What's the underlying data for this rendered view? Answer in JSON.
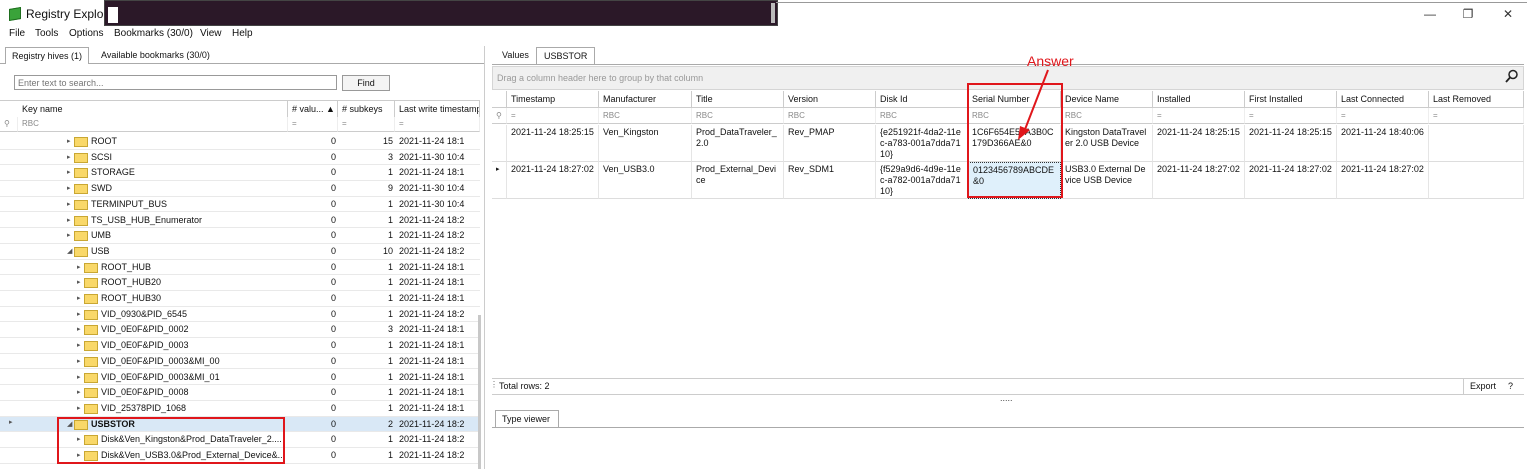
{
  "window": {
    "title": "Registry Explore",
    "minimize": "—",
    "maximize": "❐",
    "close": "✕"
  },
  "menu": [
    "File",
    "Tools",
    "Options",
    "Bookmarks (30/0)",
    "View",
    "Help"
  ],
  "left_tabs": [
    "Registry hives (1)",
    "Available bookmarks (30/0)"
  ],
  "search": {
    "placeholder": "Enter text to search...",
    "find_label": "Find"
  },
  "left_grid": {
    "headers": [
      "Key name",
      "# valu...",
      "# subkeys",
      "Last write timestamp"
    ],
    "filter_glyph": "RBC",
    "filter_eq": "=",
    "rows": [
      {
        "name": "ROOT",
        "values": "0",
        "subkeys": "15",
        "ts": "2021-11-24 18:1",
        "level": 1
      },
      {
        "name": "SCSI",
        "values": "0",
        "subkeys": "3",
        "ts": "2021-11-30 10:4",
        "level": 1
      },
      {
        "name": "STORAGE",
        "values": "0",
        "subkeys": "1",
        "ts": "2021-11-24 18:1",
        "level": 1
      },
      {
        "name": "SWD",
        "values": "0",
        "subkeys": "9",
        "ts": "2021-11-30 10:4",
        "level": 1
      },
      {
        "name": "TERMINPUT_BUS",
        "values": "0",
        "subkeys": "1",
        "ts": "2021-11-30 10:4",
        "level": 1
      },
      {
        "name": "TS_USB_HUB_Enumerator",
        "values": "0",
        "subkeys": "1",
        "ts": "2021-11-24 18:2",
        "level": 1
      },
      {
        "name": "UMB",
        "values": "0",
        "subkeys": "1",
        "ts": "2021-11-24 18:2",
        "level": 1
      },
      {
        "name": "USB",
        "values": "0",
        "subkeys": "10",
        "ts": "2021-11-24 18:2",
        "level": 1
      },
      {
        "name": "ROOT_HUB",
        "values": "0",
        "subkeys": "1",
        "ts": "2021-11-24 18:1",
        "level": 2
      },
      {
        "name": "ROOT_HUB20",
        "values": "0",
        "subkeys": "1",
        "ts": "2021-11-24 18:1",
        "level": 2
      },
      {
        "name": "ROOT_HUB30",
        "values": "0",
        "subkeys": "1",
        "ts": "2021-11-24 18:1",
        "level": 2
      },
      {
        "name": "VID_0930&PID_6545",
        "values": "0",
        "subkeys": "1",
        "ts": "2021-11-24 18:2",
        "level": 2
      },
      {
        "name": "VID_0E0F&PID_0002",
        "values": "0",
        "subkeys": "3",
        "ts": "2021-11-24 18:1",
        "level": 2
      },
      {
        "name": "VID_0E0F&PID_0003",
        "values": "0",
        "subkeys": "1",
        "ts": "2021-11-24 18:1",
        "level": 2
      },
      {
        "name": "VID_0E0F&PID_0003&MI_00",
        "values": "0",
        "subkeys": "1",
        "ts": "2021-11-24 18:1",
        "level": 2
      },
      {
        "name": "VID_0E0F&PID_0003&MI_01",
        "values": "0",
        "subkeys": "1",
        "ts": "2021-11-24 18:1",
        "level": 2
      },
      {
        "name": "VID_0E0F&PID_0008",
        "values": "0",
        "subkeys": "1",
        "ts": "2021-11-24 18:1",
        "level": 2
      },
      {
        "name": "VID_25378PID_1068",
        "values": "0",
        "subkeys": "1",
        "ts": "2021-11-24 18:1",
        "level": 2
      },
      {
        "name": "USBSTOR",
        "values": "0",
        "subkeys": "2",
        "ts": "2021-11-24 18:2",
        "level": 1,
        "selected": true
      },
      {
        "name": "Disk&Ven_Kingston&Prod_DataTraveler_2....",
        "values": "0",
        "subkeys": "1",
        "ts": "2021-11-24 18:2",
        "level": 2
      },
      {
        "name": "Disk&Ven_USB3.0&Prod_External_Device&...",
        "values": "0",
        "subkeys": "1",
        "ts": "2021-11-24 18:2",
        "level": 2
      }
    ]
  },
  "right_tabs": [
    "Values",
    "USBSTOR"
  ],
  "group_hint": "Drag a column header here to group by that column",
  "right_grid": {
    "headers": [
      "Timestamp",
      "Manufacturer",
      "Title",
      "Version",
      "Disk Id",
      "Serial Number",
      "Device Name",
      "Installed",
      "First Installed",
      "Last Connected",
      "Last Removed"
    ],
    "rows": [
      [
        "2021-11-24 18:25:15",
        "Ven_Kingston",
        "Prod_DataTraveler_2.0",
        "Rev_PMAP",
        "{e251921f-4da2-11ec-a783-001a7dda7110}",
        "1C6F654E59A3B0C179D366AE&0",
        "Kingston DataTraveler 2.0 USB Device",
        "2021-11-24 18:25:15",
        "2021-11-24 18:25:15",
        "2021-11-24 18:40:06",
        ""
      ],
      [
        "2021-11-24 18:27:02",
        "Ven_USB3.0",
        "Prod_External_Device",
        "Rev_SDM1",
        "{f529a9d6-4d9e-11ec-a782-001a7dda7110}",
        "0123456789ABCDE&0",
        "USB3.0 External Device USB Device",
        "2021-11-24 18:27:02",
        "2021-11-24 18:27:02",
        "2021-11-24 18:27:02",
        ""
      ]
    ]
  },
  "footer": {
    "total_rows": "Total rows: 2",
    "export": "Export",
    "help": "?",
    "splitter": "....."
  },
  "type_viewer": {
    "tab": "Type viewer"
  },
  "annotation": {
    "label": "Answer",
    "color": "#e0161b"
  }
}
